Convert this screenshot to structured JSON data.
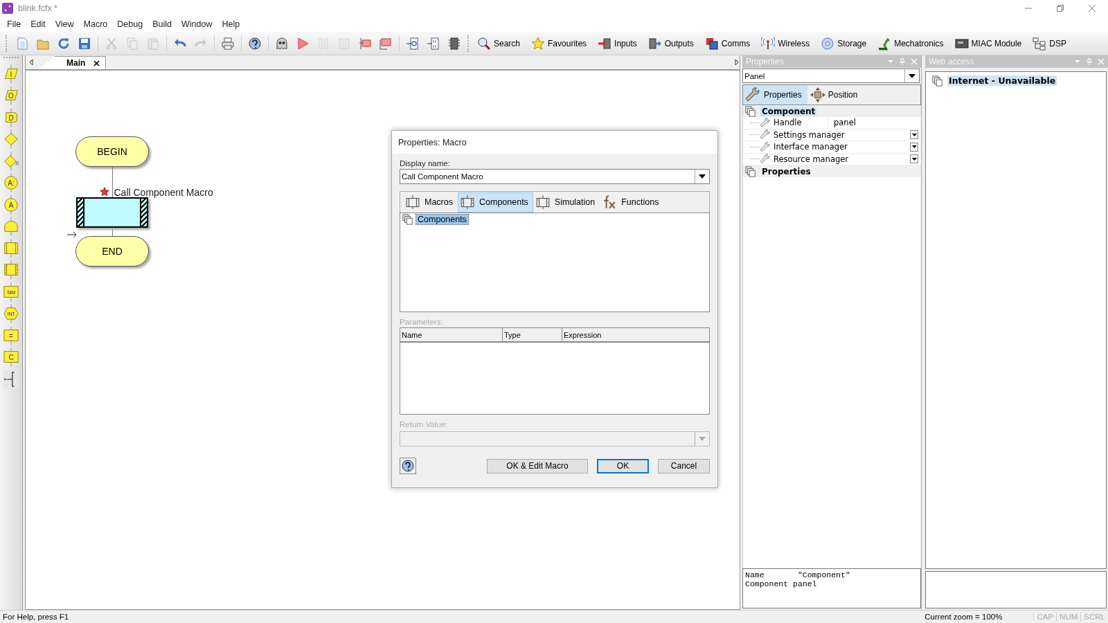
{
  "window": {
    "title": "blink.fcfx *"
  },
  "menu": [
    "File",
    "Edit",
    "View",
    "Macro",
    "Debug",
    "Build",
    "Window",
    "Help"
  ],
  "toolbar": {
    "icon_buttons": [
      {
        "kind": "new",
        "disabled": false
      },
      {
        "kind": "open",
        "disabled": false
      },
      {
        "kind": "refresh",
        "disabled": false
      },
      {
        "kind": "save",
        "disabled": false
      },
      {
        "kind": "sep"
      },
      {
        "kind": "cut",
        "disabled": true
      },
      {
        "kind": "copy",
        "disabled": true
      },
      {
        "kind": "paste",
        "disabled": true
      },
      {
        "kind": "sep"
      },
      {
        "kind": "undo",
        "disabled": false
      },
      {
        "kind": "redo",
        "disabled": true
      },
      {
        "kind": "sep"
      },
      {
        "kind": "print",
        "disabled": false
      },
      {
        "kind": "sep"
      },
      {
        "kind": "help",
        "disabled": false
      },
      {
        "kind": "sep"
      },
      {
        "kind": "ghost",
        "disabled": false
      },
      {
        "kind": "play",
        "disabled": false
      },
      {
        "kind": "pause",
        "disabled": true
      },
      {
        "kind": "stop",
        "disabled": true
      },
      {
        "kind": "step-into",
        "disabled": false
      },
      {
        "kind": "step-over",
        "disabled": false
      },
      {
        "kind": "sep"
      },
      {
        "kind": "chip-c",
        "disabled": false
      },
      {
        "kind": "chip-bin",
        "disabled": false
      },
      {
        "kind": "chip",
        "disabled": false
      }
    ],
    "category_buttons": [
      {
        "kind": "search",
        "label": "Search"
      },
      {
        "kind": "star",
        "label": "Favourites"
      },
      {
        "kind": "inputs",
        "label": "Inputs"
      },
      {
        "kind": "outputs",
        "label": "Outputs"
      },
      {
        "kind": "comms",
        "label": "Comms"
      },
      {
        "kind": "wireless",
        "label": "Wireless"
      },
      {
        "kind": "disc",
        "label": "Storage"
      },
      {
        "kind": "arm",
        "label": "Mechatronics"
      },
      {
        "kind": "module",
        "label": "MIAC Module"
      },
      {
        "kind": "tree",
        "label": "DSP"
      }
    ]
  },
  "palette": [
    {
      "kind": "parallelogram",
      "glyph": "I"
    },
    {
      "kind": "parallelogram",
      "glyph": "O"
    },
    {
      "kind": "delay",
      "glyph": "D"
    },
    {
      "kind": "diamond"
    },
    {
      "kind": "switch"
    },
    {
      "kind": "circle",
      "glyph": "A:"
    },
    {
      "kind": "circle",
      "glyph": "A"
    },
    {
      "kind": "loop"
    },
    {
      "kind": "macro"
    },
    {
      "kind": "component"
    },
    {
      "kind": "box",
      "glyph": "SIM"
    },
    {
      "kind": "hexagon",
      "glyph": "INT"
    },
    {
      "kind": "box",
      "glyph": "="
    },
    {
      "kind": "box",
      "glyph": "C"
    },
    {
      "kind": "comment"
    }
  ],
  "editor": {
    "tabs": [
      {
        "label": "Main",
        "selected": true
      }
    ],
    "flowchart": [
      {
        "kind": "terminal",
        "label": "BEGIN"
      },
      {
        "kind": "component-macro",
        "label": "Call Component Macro",
        "flagged": true
      },
      {
        "kind": "terminal",
        "label": "END"
      }
    ]
  },
  "dialog": {
    "title": "Properties: Macro",
    "display_name_label": "Display name:",
    "display_name": "Call Component Macro",
    "tabs": [
      {
        "kind": "macro",
        "label": "Macros",
        "selected": false
      },
      {
        "kind": "component",
        "label": "Components",
        "selected": true
      },
      {
        "kind": "simulation",
        "label": "Simulation",
        "selected": false
      },
      {
        "kind": "function",
        "label": "Functions",
        "selected": false
      }
    ],
    "tree": [
      {
        "label": "Components",
        "selected": true
      }
    ],
    "parameters_label": "Parameters:",
    "parameter_columns": [
      "Name",
      "Type",
      "Expression"
    ],
    "return_value_label": "Return Value:",
    "buttons": [
      {
        "kind": "plain",
        "label": "OK & Edit Macro"
      },
      {
        "kind": "default",
        "label": "OK"
      },
      {
        "kind": "plain",
        "label": "Cancel"
      }
    ]
  },
  "properties_panel": {
    "title": "Properties",
    "selector": "Panel",
    "tabs": [
      {
        "kind": "wrench",
        "label": "Properties",
        "selected": true
      },
      {
        "kind": "move",
        "label": "Position",
        "selected": false
      }
    ],
    "tree": [
      {
        "label": "Component",
        "selected": true,
        "children": [
          {
            "name": "Handle",
            "value": "panel"
          },
          {
            "name": "Settings manager",
            "dropdown": true
          },
          {
            "name": "Interface manager",
            "dropdown": true
          },
          {
            "name": "Resource manager",
            "dropdown": true
          }
        ]
      },
      {
        "label": "Properties",
        "selected": false
      }
    ],
    "info": [
      "Name       \"Component\"",
      "Component panel"
    ]
  },
  "web_panel": {
    "title": "Web access",
    "tree": [
      {
        "label": "Internet - Unavailable",
        "selected": true
      }
    ]
  },
  "status_bar": {
    "help": "For Help, press F1",
    "zoom": "Current zoom = 100%",
    "indicators": [
      {
        "label": "CAP",
        "on": false
      },
      {
        "label": "NUM",
        "on": false
      },
      {
        "label": "SCRL",
        "on": false
      }
    ]
  }
}
